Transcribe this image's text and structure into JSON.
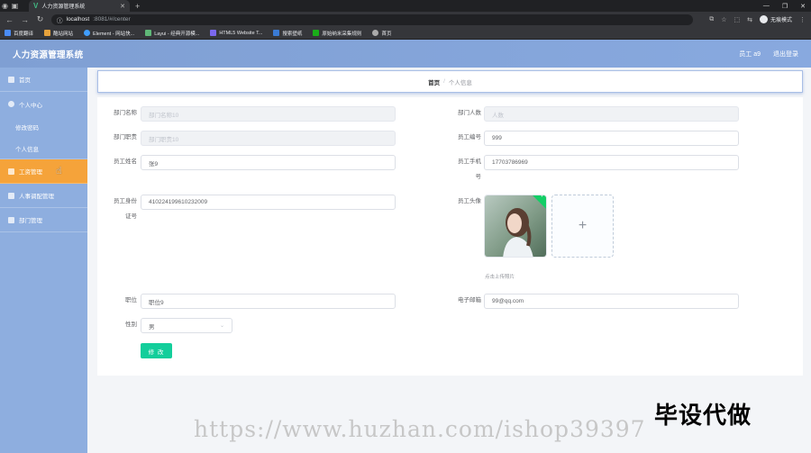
{
  "browser": {
    "tab_title": "人力资源管理系统",
    "url_host": "localhost",
    "url_rest": ":8081/#/center",
    "profile_name": "无痕模式",
    "bookmarks": [
      "百度翻译",
      "酷站网站",
      "Element - 网站快...",
      "Layui - 经典开源模...",
      "HTML5 Website T...",
      "搜索壁纸",
      "原始纳米采集规则",
      "首页"
    ]
  },
  "header": {
    "title": "人力资源管理系统",
    "user": "员工 a9",
    "logout": "退出登录"
  },
  "sidebar": {
    "items": [
      {
        "label": "首页",
        "icon": "home-icon"
      },
      {
        "label": "个人中心",
        "icon": "user-icon"
      },
      {
        "label": "修改密码",
        "icon": ""
      },
      {
        "label": "个人信息",
        "icon": ""
      },
      {
        "label": "工资管理",
        "icon": "salary-icon"
      },
      {
        "label": "人事调配管理",
        "icon": "transfer-icon"
      },
      {
        "label": "部门管理",
        "icon": "department-icon"
      }
    ],
    "active_index": 4
  },
  "breadcrumb": {
    "home": "首页",
    "separator": "/",
    "current": "个人信息"
  },
  "form": {
    "dept_name": {
      "label": "部门名称",
      "placeholder": "部门名称10"
    },
    "dept_count": {
      "label": "部门人数",
      "placeholder": "人数"
    },
    "dept_duty": {
      "label": "部门职责",
      "placeholder": "部门职责10"
    },
    "emp_no": {
      "label": "员工编号",
      "value": "999"
    },
    "emp_name": {
      "label": "员工姓名",
      "value": "张9"
    },
    "emp_phone": {
      "label_line1": "员工手机",
      "label_line2": "号",
      "value": "17703786969"
    },
    "emp_id": {
      "label_line1": "员工身份",
      "label_line2": "证号",
      "value": "410224199610232009"
    },
    "emp_avatar": {
      "label": "员工头像",
      "upload_tip": "点击上传照片",
      "plus": "+"
    },
    "position": {
      "label": "职位",
      "value": "职位9"
    },
    "email": {
      "label": "电子邮箱",
      "value": "99@qq.com"
    },
    "gender": {
      "label": "性别",
      "value": "男"
    },
    "submit": "修 改"
  },
  "overlays": {
    "promo": "毕设代做",
    "watermark": "https://www.huzhan.com/ishop39397"
  },
  "colors": {
    "header": "#88a9df",
    "sidebar": "#8eaedf",
    "active_menu": "#f5a33a",
    "submit": "#13ce9b"
  }
}
